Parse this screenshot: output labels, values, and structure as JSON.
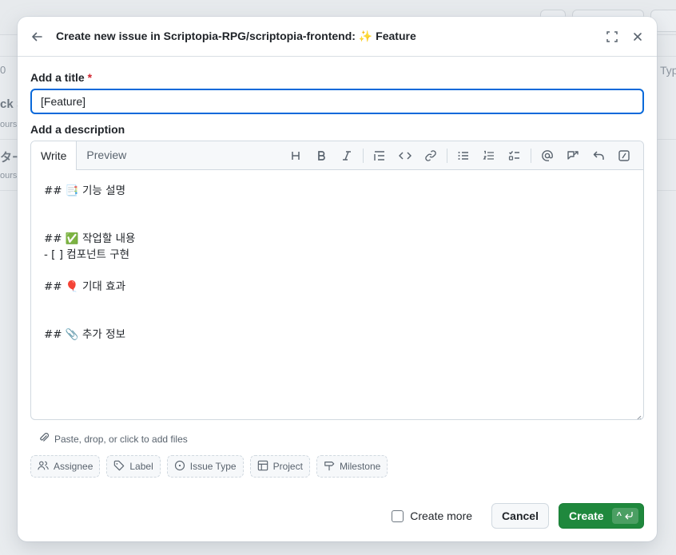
{
  "background": {
    "fragments": [
      "0",
      "ck S",
      "ours",
      "ター",
      "ours",
      "Typ"
    ]
  },
  "modal": {
    "title": "Create new issue in Scriptopia-RPG/scriptopia-frontend: ✨ Feature",
    "title_label": "Add a title",
    "required_mark": "*",
    "title_value": "[Feature]",
    "description_label": "Add a description",
    "tabs": [
      "Write",
      "Preview"
    ],
    "toolbar_icons": [
      "heading-icon",
      "bold-icon",
      "italic-icon",
      "quote-icon",
      "code-icon",
      "link-icon",
      "unordered-list-icon",
      "ordered-list-icon",
      "task-list-icon",
      "mention-icon",
      "reference-icon",
      "undo-icon",
      "slash-command-icon"
    ],
    "description_value": "## 📑 기능 설명\n\n\n## ✅ 작업할 내용\n- [ ] 컴포넌트 구현\n\n## 🎈 기대 효과\n\n\n## 📎 추가 정보",
    "attach_hint": "Paste, drop, or click to add files",
    "metadata_buttons": [
      {
        "label": "Assignee",
        "icon": "people-icon"
      },
      {
        "label": "Label",
        "icon": "tag-icon"
      },
      {
        "label": "Issue Type",
        "icon": "issue-type-icon"
      },
      {
        "label": "Project",
        "icon": "table-icon"
      },
      {
        "label": "Milestone",
        "icon": "milestone-icon"
      }
    ],
    "create_more_label": "Create more",
    "cancel_label": "Cancel",
    "create_label": "Create",
    "create_shortcut": "^"
  },
  "colors": {
    "primary_button": "#1f883d",
    "focus_border": "#0969da",
    "required": "#d1242f"
  }
}
